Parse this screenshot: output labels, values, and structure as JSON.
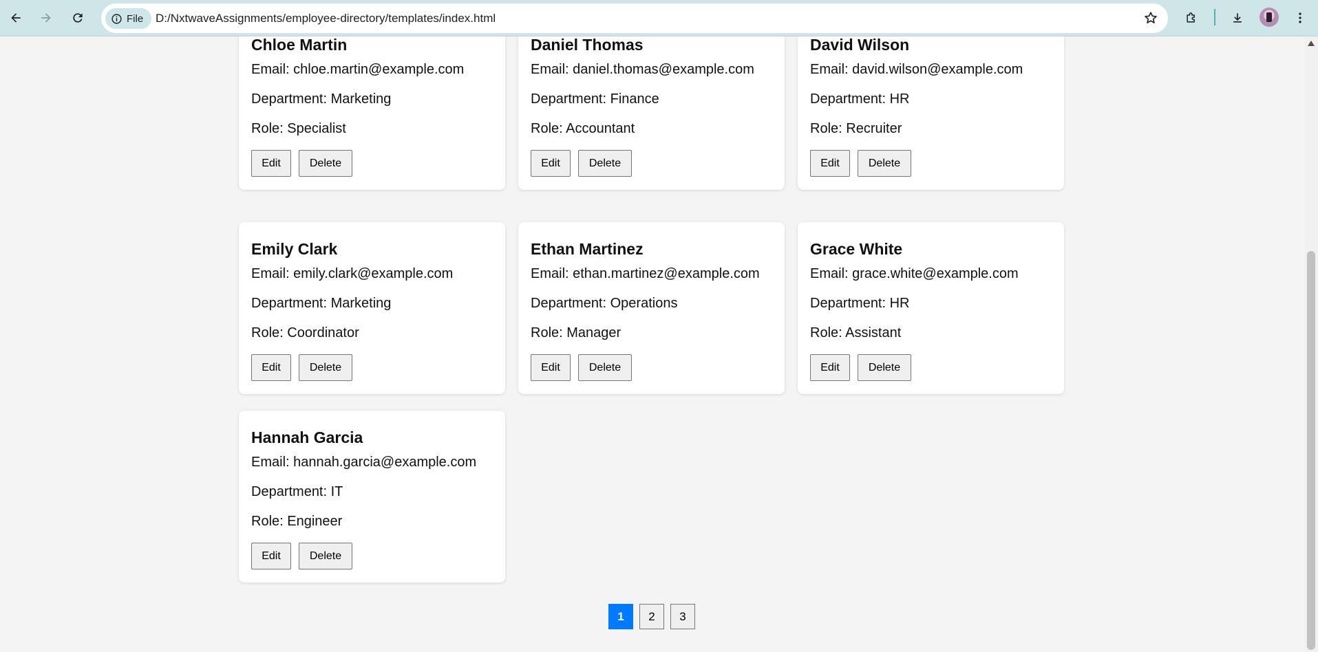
{
  "browser": {
    "site_chip_label": "File",
    "url": "D:/NxtwaveAssignments/employee-directory/templates/index.html"
  },
  "employees": [
    {
      "name": "Chloe Martin",
      "email": "Email: chloe.martin@example.com",
      "department": "Department: Marketing",
      "role": "Role: Specialist"
    },
    {
      "name": "Daniel Thomas",
      "email": "Email: daniel.thomas@example.com",
      "department": "Department: Finance",
      "role": "Role: Accountant"
    },
    {
      "name": "David Wilson",
      "email": "Email: david.wilson@example.com",
      "department": "Department: HR",
      "role": "Role: Recruiter"
    },
    {
      "name": "Emily Clark",
      "email": "Email: emily.clark@example.com",
      "department": "Department: Marketing",
      "role": "Role: Coordinator"
    },
    {
      "name": "Ethan Martinez",
      "email": "Email: ethan.martinez@example.com",
      "department": "Department: Operations",
      "role": "Role: Manager"
    },
    {
      "name": "Grace White",
      "email": "Email: grace.white@example.com",
      "department": "Department: HR",
      "role": "Role: Assistant"
    },
    {
      "name": "Hannah Garcia",
      "email": "Email: hannah.garcia@example.com",
      "department": "Department: IT",
      "role": "Role: Engineer"
    }
  ],
  "card_actions": {
    "edit_label": "Edit",
    "delete_label": "Delete"
  },
  "pagination": {
    "pages": [
      "1",
      "2",
      "3"
    ],
    "current": "1"
  },
  "colors": {
    "accent": "#007bff",
    "toolbar_bg": "#cfe6e9"
  }
}
